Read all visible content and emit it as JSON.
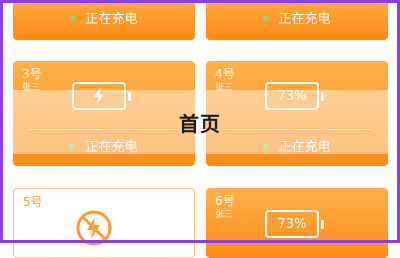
{
  "page_title": "首页",
  "cards": [
    {
      "status": "正在充电"
    },
    {
      "status": "正在充电"
    },
    {
      "number": "3号",
      "owner": "张三",
      "battery_icon": "charging-bolt-icon",
      "status": "正在充电"
    },
    {
      "number": "4号",
      "owner": "张三",
      "battery_level": "73%",
      "status": "正在充电"
    },
    {
      "number": "5号",
      "state_icon": "not-charging-icon"
    },
    {
      "number": "6号",
      "owner": "张三",
      "battery_level": "73%"
    }
  ],
  "colors": {
    "accent": "#ff9a2b",
    "status_dot": "#7be37b",
    "frame": "#8a3cf0"
  }
}
